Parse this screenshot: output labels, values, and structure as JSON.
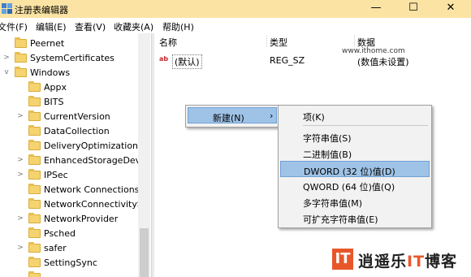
{
  "window": {
    "title": "注册表编辑器",
    "controls": [
      "—",
      "☐",
      "✕"
    ],
    "accent": "#fbe3a4"
  },
  "menubar": {
    "items": [
      "文件(F)",
      "编辑(E)",
      "查看(V)",
      "收藏夹(A)",
      "帮助(H)"
    ]
  },
  "tree": {
    "items": [
      {
        "label": "Peernet",
        "expand": ""
      },
      {
        "label": "SystemCertificates",
        "expand": ">"
      },
      {
        "label": "Windows",
        "expand": "v"
      },
      {
        "label": "Appx",
        "expand": ""
      },
      {
        "label": "BITS",
        "expand": ""
      },
      {
        "label": "CurrentVersion",
        "expand": ">"
      },
      {
        "label": "DataCollection",
        "expand": ""
      },
      {
        "label": "DeliveryOptimization",
        "expand": ""
      },
      {
        "label": "EnhancedStorageDevi",
        "expand": ">"
      },
      {
        "label": "IPSec",
        "expand": ">"
      },
      {
        "label": "Network Connections",
        "expand": ""
      },
      {
        "label": "NetworkConnectivityS",
        "expand": ""
      },
      {
        "label": "NetworkProvider",
        "expand": ">"
      },
      {
        "label": "Psched",
        "expand": ""
      },
      {
        "label": "safer",
        "expand": ">"
      },
      {
        "label": "SettingSync",
        "expand": ""
      }
    ]
  },
  "list": {
    "headers": {
      "name": "名称",
      "type": "类型",
      "data": "数据"
    },
    "rows": [
      {
        "icon": "ab",
        "name": "(默认)",
        "type": "REG_SZ",
        "data": "(数值未设置)"
      }
    ]
  },
  "watermark": "www.ithome.com",
  "context_menu": {
    "item": "新建(N)",
    "arrow": "›"
  },
  "submenu": {
    "items": [
      "项(K)",
      "字符串值(S)",
      "二进制值(B)",
      "DWORD (32 位)值(D)",
      "QWORD (64 位)值(Q)",
      "多字符串值(M)",
      "可扩充字符串值(E)"
    ],
    "highlighted": "DWORD (32 位)值(D)"
  },
  "logo": {
    "mark": "IT",
    "text_a": "逍遥乐",
    "text_it": "IT",
    "text_b": "博客"
  }
}
